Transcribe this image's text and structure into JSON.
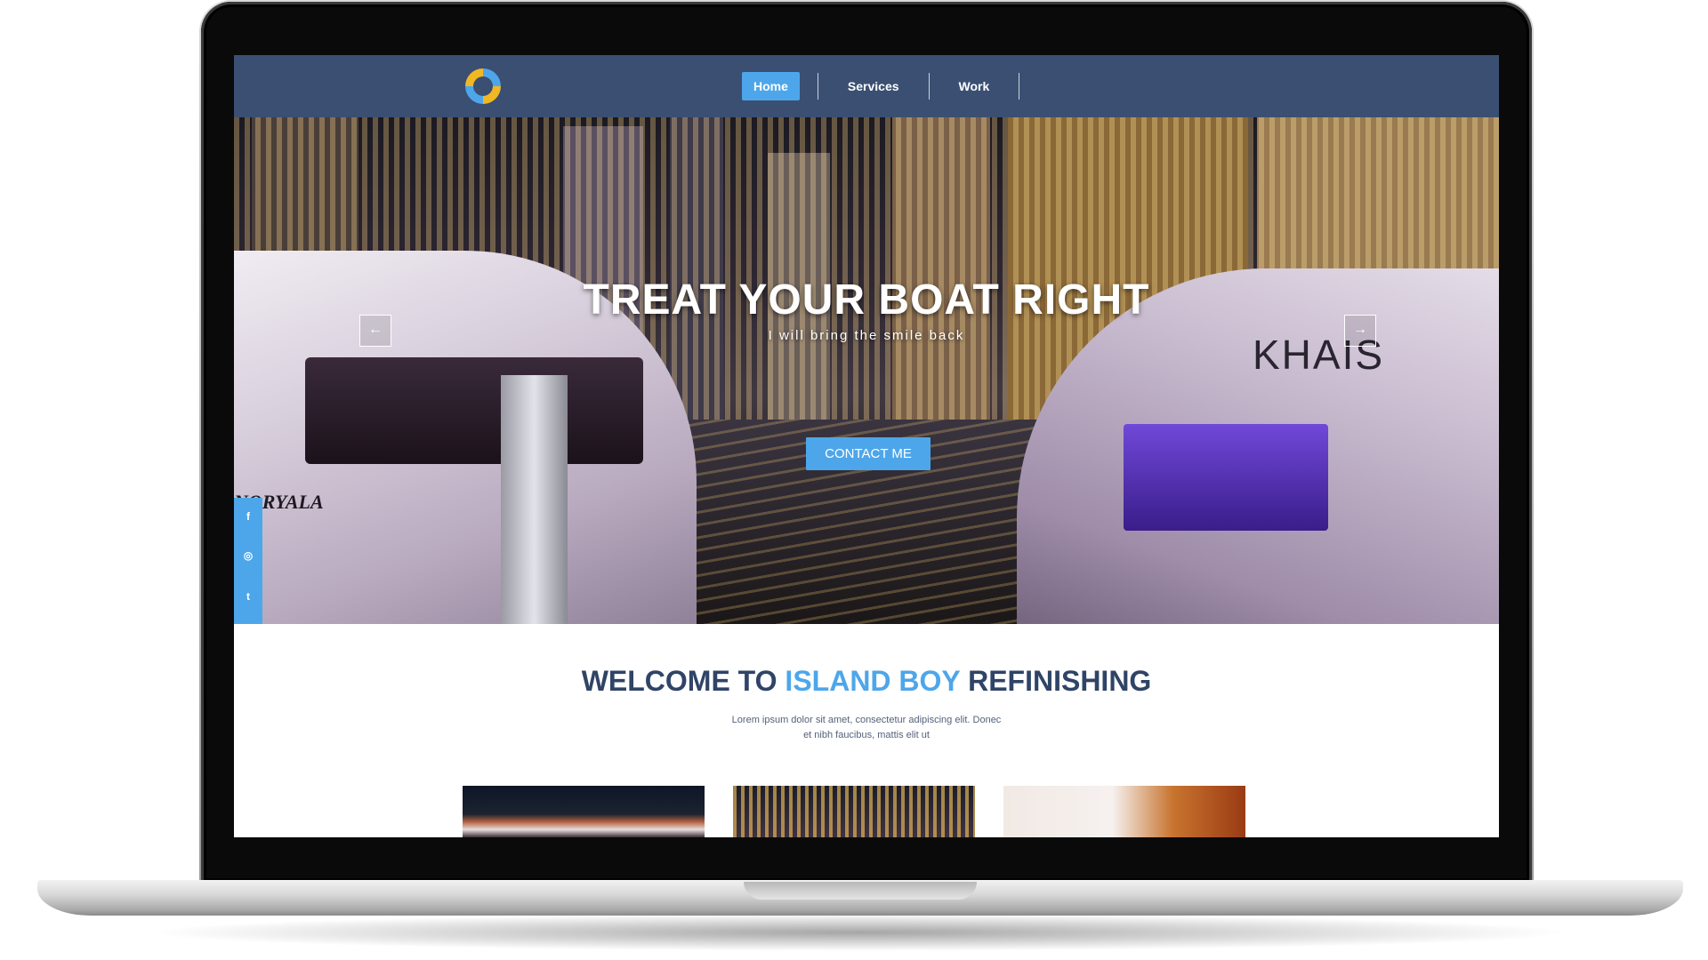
{
  "nav": {
    "logo": "logo-icon",
    "items": [
      {
        "label": "Home",
        "active": true
      },
      {
        "label": "Services",
        "active": false
      },
      {
        "label": "Work",
        "active": false
      }
    ]
  },
  "hero": {
    "title": "TREAT YOUR BOAT RIGHT",
    "subtitle": "I will bring the smile back",
    "cta_label": "CONTACT ME",
    "prev_arrow": "←",
    "next_arrow": "→",
    "boat_name": "NORYALA",
    "boat_brand": "KHAIS"
  },
  "social": [
    {
      "name": "facebook-icon",
      "glyph": "f"
    },
    {
      "name": "instagram-icon",
      "glyph": "◎"
    },
    {
      "name": "twitter-icon",
      "glyph": "t"
    }
  ],
  "welcome": {
    "prefix": "WELCOME TO ",
    "highlight": "ISLAND BOY",
    "suffix": " REFINISHING",
    "body_line1": "Lorem ipsum dolor sit amet, consectetur adipiscing elit. Donec",
    "body_line2": "et nibh faucibus, mattis elit ut"
  },
  "colors": {
    "nav_bg": "#3a4f72",
    "accent": "#4ea6ea",
    "heading": "#2f4466",
    "logo_blue": "#4ea6ea",
    "logo_yellow": "#f2b824"
  }
}
